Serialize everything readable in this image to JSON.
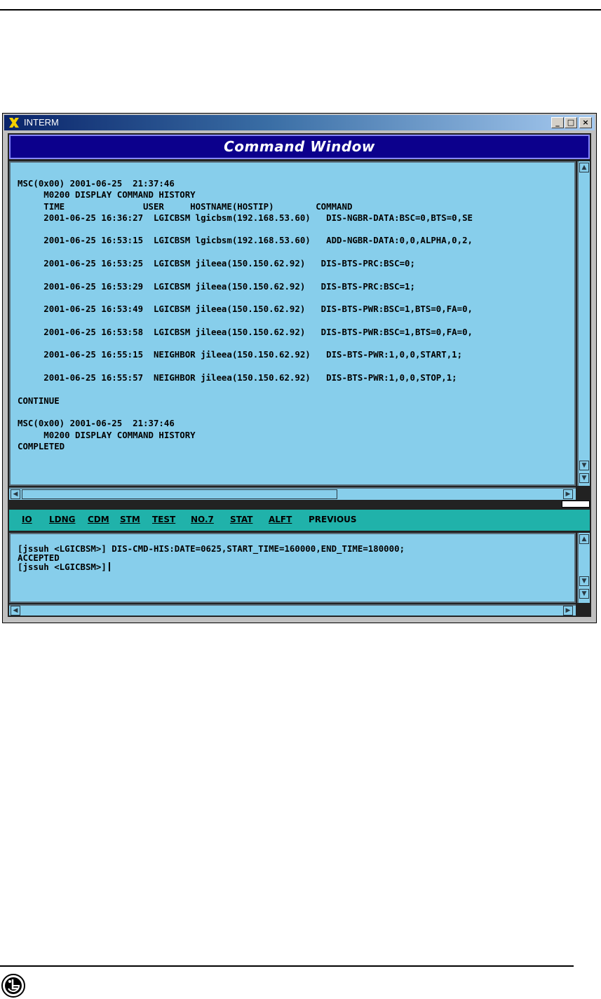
{
  "window": {
    "title": "INTERM",
    "controls": {
      "minimize": "_",
      "maximize": "□",
      "close": "×"
    }
  },
  "command_window": {
    "header": "Command Window",
    "output_lines": [
      "MSC(0x00) 2001-06-25  21:37:46",
      "     M0200 DISPLAY COMMAND HISTORY",
      "     TIME               USER     HOSTNAME(HOSTIP)        COMMAND",
      "     2001-06-25 16:36:27  LGICBSM lgicbsm(192.168.53.60)   DIS-NGBR-DATA:BSC=0,BTS=0,SE",
      "",
      "     2001-06-25 16:53:15  LGICBSM lgicbsm(192.168.53.60)   ADD-NGBR-DATA:0,0,ALPHA,0,2,",
      "",
      "     2001-06-25 16:53:25  LGICBSM jileea(150.150.62.92)   DIS-BTS-PRC:BSC=0;",
      "",
      "     2001-06-25 16:53:29  LGICBSM jileea(150.150.62.92)   DIS-BTS-PRC:BSC=1;",
      "",
      "     2001-06-25 16:53:49  LGICBSM jileea(150.150.62.92)   DIS-BTS-PWR:BSC=1,BTS=0,FA=0,",
      "",
      "     2001-06-25 16:53:58  LGICBSM jileea(150.150.62.92)   DIS-BTS-PWR:BSC=1,BTS=0,FA=0,",
      "",
      "     2001-06-25 16:55:15  NEIGHBOR jileea(150.150.62.92)   DIS-BTS-PWR:1,0,0,START,1;",
      "",
      "     2001-06-25 16:55:57  NEIGHBOR jileea(150.150.62.92)   DIS-BTS-PWR:1,0,0,STOP,1;",
      "",
      "CONTINUE",
      "",
      "MSC(0x00) 2001-06-25  21:37:46",
      "     M0200 DISPLAY COMMAND HISTORY",
      "COMPLETED"
    ]
  },
  "menu": {
    "items": [
      "IO",
      "LDNG",
      "CDM",
      "STM",
      "TEST",
      "NO.7",
      "STAT",
      "ALFT",
      "PREVIOUS"
    ]
  },
  "input": {
    "lines": [
      "[jssuh <LGICBSM>] DIS-CMD-HIS:DATE=0625,START_TIME=160000,END_TIME=180000;",
      "ACCEPTED",
      "[jssuh <LGICBSM>]"
    ]
  },
  "scroll_arrows": {
    "up": "▲",
    "down": "▼",
    "left": "◀",
    "right": "▶"
  }
}
